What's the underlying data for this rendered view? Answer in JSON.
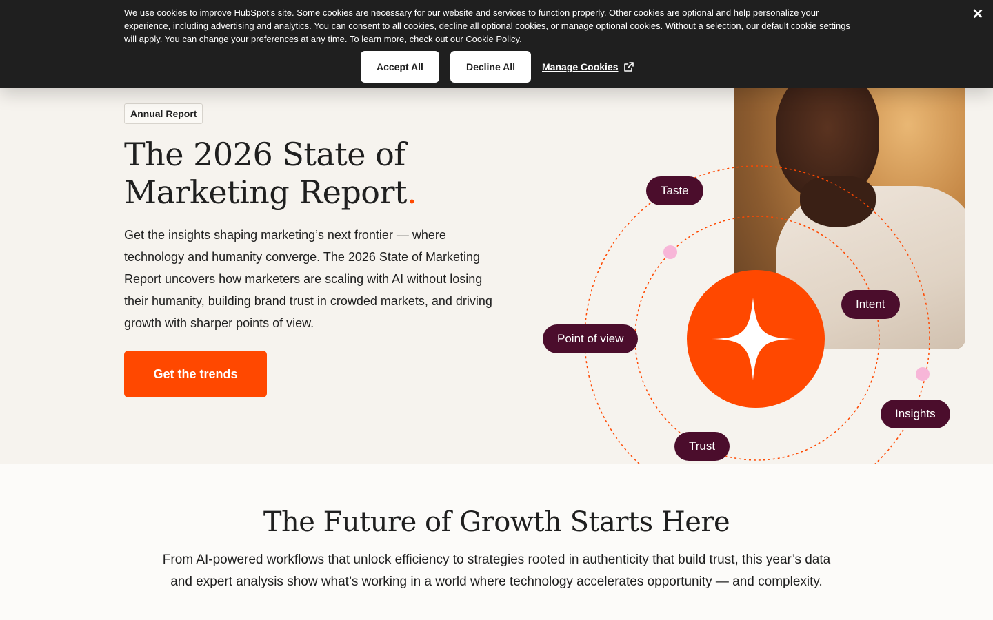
{
  "cookie_banner": {
    "text": "We use cookies to improve HubSpot’s site. Some cookies are necessary for our website and services to function properly. Other cookies are optional and help personalize your experience, including advertising and analytics. You can consent to all cookies, decline all optional cookies, or manage optional cookies. Without a selection, our default cookie settings will apply. You can change your preferences at any time. To learn more, check out our",
    "policy_link": "Cookie Policy",
    "period": ".",
    "accept_label": "Accept All",
    "decline_label": "Decline All",
    "manage_label": "Manage Cookies",
    "close_icon": "close-icon",
    "manage_icon": "external-link-icon"
  },
  "hero": {
    "badge": "Annual Report",
    "title": "The 2026 State of Marketing Report",
    "title_dot": ".",
    "description": "Get the insights shaping marketing’s next frontier — where technology and humanity converge. The 2026 State of Marketing Report uncovers how marketers are scaling with AI without losing their humanity, building brand trust in crowded markets, and driving growth with sharper points of view.",
    "cta_label": "Get the trends",
    "pills": [
      "Taste",
      "Intent",
      "Point of view",
      "Insights",
      "Trust"
    ],
    "center_icon": "sparkle-icon"
  },
  "section2": {
    "title": "The Future of Growth Starts Here",
    "description": "From AI-powered workflows that unlock efficiency to strategies rooted in authenticity that build trust, this year’s data and expert analysis show what’s working in a world where technology accelerates opportunity — and complexity."
  },
  "colors": {
    "accent": "#ff4800",
    "pill": "#4b0d2c",
    "banner": "#1f1f1f",
    "hero_bg": "#f6f3ee",
    "dot_pink": "#f7b6d8"
  }
}
